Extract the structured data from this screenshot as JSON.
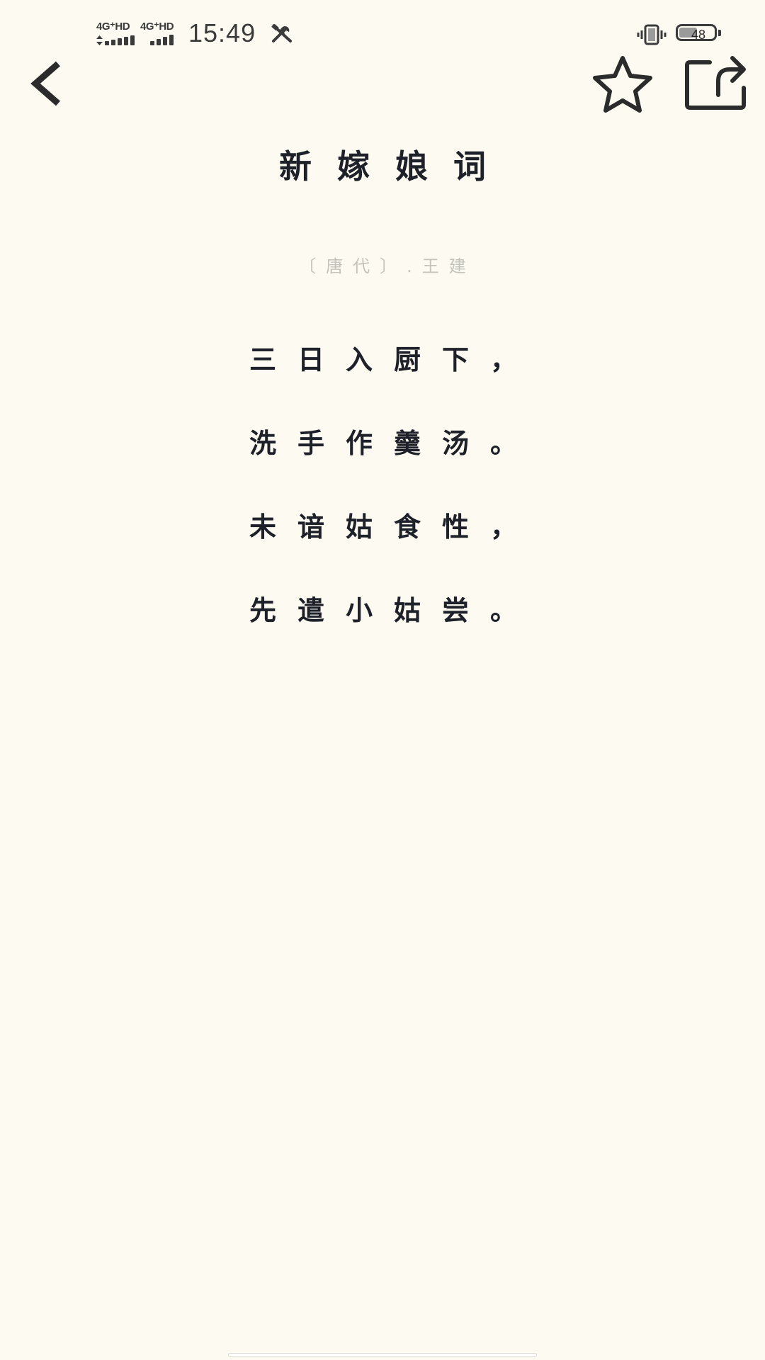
{
  "status_bar": {
    "sim1_label": "4G⁺HD",
    "sim2_label": "4G⁺HD",
    "time": "15:49",
    "battery_level": "48",
    "battery_fraction": 0.48,
    "icons": [
      "signal-icon",
      "tools-icon",
      "vibrate-icon",
      "battery-icon"
    ]
  },
  "toolbar": {
    "back_icon": "chevron-left-icon",
    "favorite_icon": "star-outline-icon",
    "share_icon": "share-icon"
  },
  "poem": {
    "title": "新嫁娘词",
    "dynasty_author": "〔唐代〕.王建",
    "lines": [
      "三日入厨下，",
      "洗手作羹汤。",
      "未谙姑食性，",
      "先遣小姑尝。"
    ]
  },
  "colors": {
    "background": "#FDFBF1",
    "text": "#1E2129",
    "meta_text": "#C4C3BC",
    "icon": "#2B2B2B"
  }
}
